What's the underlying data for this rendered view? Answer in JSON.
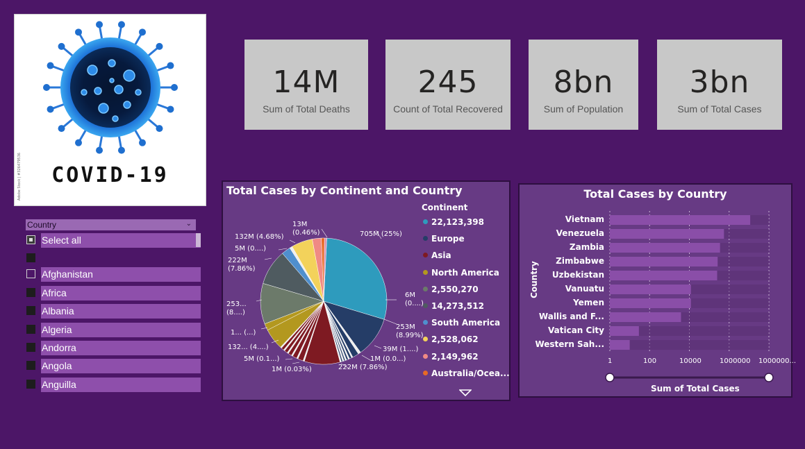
{
  "logo": {
    "title": "COVID-19",
    "stamp": "Adobe Stock | #326479536"
  },
  "kpis": [
    {
      "value": "14M",
      "label": "Sum of Total Deaths"
    },
    {
      "value": "245",
      "label": "Count of Total Recovered"
    },
    {
      "value": "8bn",
      "label": "Sum of Population"
    },
    {
      "value": "3bn",
      "label": "Sum of Total Cases"
    }
  ],
  "slicer": {
    "header": "Country",
    "items": [
      {
        "label": "Select all",
        "state": "partial"
      },
      {
        "label": "",
        "state": "checked"
      },
      {
        "label": "Afghanistan",
        "state": "unchecked"
      },
      {
        "label": "Africa",
        "state": "checked"
      },
      {
        "label": "Albania",
        "state": "checked"
      },
      {
        "label": "Algeria",
        "state": "checked"
      },
      {
        "label": "Andorra",
        "state": "checked"
      },
      {
        "label": "Angola",
        "state": "checked"
      },
      {
        "label": "Anguilla",
        "state": "checked"
      }
    ]
  },
  "pie_panel": {
    "title": "Total Cases by Continent and Country",
    "legend_title": "Continent",
    "legend": [
      {
        "label": "22,123,398",
        "color": "#2e9bbd"
      },
      {
        "label": "Europe",
        "color": "#253d67"
      },
      {
        "label": "Asia",
        "color": "#7e1a22"
      },
      {
        "label": "North America",
        "color": "#b3981f"
      },
      {
        "label": "2,550,270",
        "color": "#6c7a6a"
      },
      {
        "label": "14,273,512",
        "color": "#4f5b60"
      },
      {
        "label": "South America",
        "color": "#4f8fce"
      },
      {
        "label": "2,528,062",
        "color": "#f3d25b"
      },
      {
        "label": "2,149,962",
        "color": "#f08a84"
      },
      {
        "label": "Australia/Ocea...",
        "color": "#e86a25"
      }
    ],
    "labels": [
      "705M (25%)",
      "6M (0....)",
      "253M (8.99%)",
      "39M (1....)",
      "1M (0.0...)",
      "222M (7.86%)",
      "1M (0.03%)",
      "5M (0.1...)",
      "132... (4....)",
      "1... (...)",
      "253... (8....)",
      "222M (7.86%)",
      "5M (0....)",
      "132M (4.68%)",
      "13M (0.46%)"
    ]
  },
  "bar_panel": {
    "title": "Total Cases by Country",
    "y_axis_title": "Country",
    "x_axis_title": "Sum of Total Cases",
    "x_ticks": [
      "1",
      "100",
      "10000",
      "1000000",
      "1000000..."
    ]
  },
  "chart_data": {
    "type": "bar",
    "orientation": "horizontal",
    "title": "Total Cases by Country",
    "xlabel": "Sum of Total Cases",
    "ylabel": "Country",
    "x_scale": "log",
    "xlim": [
      1,
      100000000
    ],
    "categories": [
      "Vietnam",
      "Venezuela",
      "Zambia",
      "Zimbabwe",
      "Uzbekistan",
      "Vanuatu",
      "Yemen",
      "Wallis and F...",
      "Vatican City",
      "Western Sah..."
    ],
    "values": [
      11500000,
      552000,
      349000,
      265000,
      250000,
      12000,
      12000,
      3800,
      29,
      10
    ],
    "color": "#8a4ea8",
    "grid": true
  },
  "colors": {
    "background": "#4c1667",
    "panel": "#673a84",
    "kpi": "#c8c8c8",
    "slicer_item": "#8e4fab",
    "bar": "#8a4ea8"
  }
}
